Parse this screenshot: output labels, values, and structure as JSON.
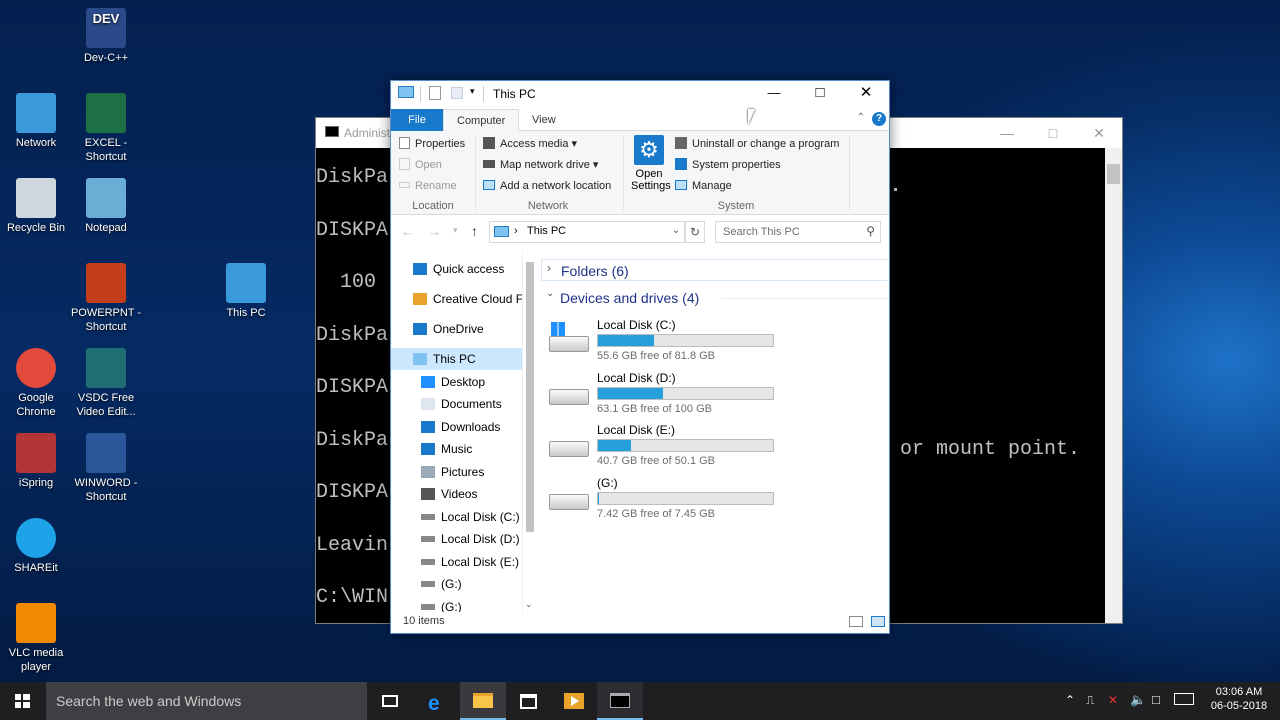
{
  "desktop": {
    "icons": [
      {
        "label": "Dev-C++"
      },
      {
        "label": "Network"
      },
      {
        "label": "EXCEL - Shortcut"
      },
      {
        "label": "Recycle Bin"
      },
      {
        "label": "Notepad"
      },
      {
        "label": "POWERPNT - Shortcut"
      },
      {
        "label": "This PC"
      },
      {
        "label": "Google Chrome"
      },
      {
        "label": "VSDC Free Video Edit..."
      },
      {
        "label": "iSpring"
      },
      {
        "label": "WINWORD - Shortcut"
      },
      {
        "label": "SHAREit"
      },
      {
        "label": "VLC media player"
      }
    ],
    "dev_badge": "DEV"
  },
  "cmd": {
    "title": "Administ",
    "lines": [
      "DiskPa",
      "DISKPA",
      "  100",
      "DiskPa",
      "DISKPA",
      "DiskPa",
      "DISKPA",
      "Leavin",
      "C:\\WIN"
    ],
    "right_fragment": "or mount point."
  },
  "explorer": {
    "title": "This PC",
    "tabs": {
      "file": "File",
      "computer": "Computer",
      "view": "View"
    },
    "ribbon": {
      "properties": "Properties",
      "open": "Open",
      "rename": "Rename",
      "location_group": "Location",
      "access_media": "Access media",
      "map_drive": "Map network drive",
      "add_location": "Add a network location",
      "network_group": "Network",
      "open_settings_1": "Open",
      "open_settings_2": "Settings",
      "uninstall": "Uninstall or change a program",
      "system_props": "System properties",
      "manage": "Manage",
      "system_group": "System"
    },
    "address": "This PC",
    "search_placeholder": "Search This PC",
    "nav": [
      {
        "label": "Quick access",
        "indent": false
      },
      {
        "label": "Creative Cloud Fil",
        "indent": false
      },
      {
        "label": "OneDrive",
        "indent": false
      },
      {
        "label": "This PC",
        "indent": false,
        "selected": true
      },
      {
        "label": "Desktop",
        "indent": true
      },
      {
        "label": "Documents",
        "indent": true
      },
      {
        "label": "Downloads",
        "indent": true
      },
      {
        "label": "Music",
        "indent": true
      },
      {
        "label": "Pictures",
        "indent": true
      },
      {
        "label": "Videos",
        "indent": true
      },
      {
        "label": "Local Disk (C:)",
        "indent": true
      },
      {
        "label": "Local Disk (D:)",
        "indent": true
      },
      {
        "label": "Local Disk (E:)",
        "indent": true
      },
      {
        "label": "(G:)",
        "indent": true
      },
      {
        "label": "(G:)",
        "indent": true
      }
    ],
    "folders_header": "Folders (6)",
    "devices_header": "Devices and drives (4)",
    "drives": [
      {
        "name": "Local Disk (C:)",
        "free": "55.6 GB free of 81.8 GB",
        "used_fraction": 0.32
      },
      {
        "name": "Local Disk (D:)",
        "free": "63.1 GB free of 100 GB",
        "used_fraction": 0.37
      },
      {
        "name": "Local Disk (E:)",
        "free": "40.7 GB free of 50.1 GB",
        "used_fraction": 0.19
      },
      {
        "name": "(G:)",
        "free": "7.42 GB free of 7.45 GB",
        "used_fraction": 0.004
      }
    ],
    "status": "10 items"
  },
  "taskbar": {
    "search_placeholder": "Search the web and Windows",
    "time": "03:06 AM",
    "date": "06-05-2018"
  },
  "colors": {
    "accent": "#1979ca",
    "drive_bar": "#26a0da",
    "taskbar": "#1f1f22"
  }
}
